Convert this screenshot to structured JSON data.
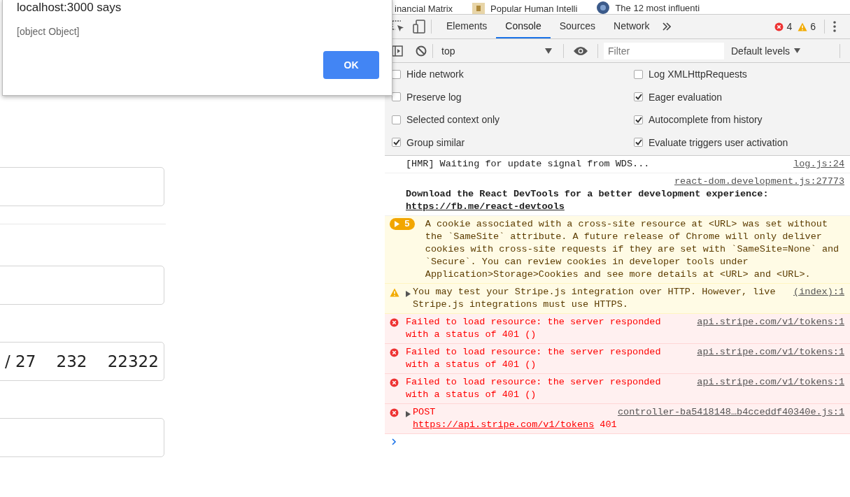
{
  "bookmarks": [
    {
      "label": "inancial Matrix"
    },
    {
      "label": "Popular Human Intelli"
    },
    {
      "label": "The 12 most influenti"
    }
  ],
  "dialog": {
    "title": "localhost:3000 says",
    "message": "[object Object]",
    "button": "OK"
  },
  "form": {
    "fields": [
      {
        "kind": "empty"
      },
      {
        "kind": "divider"
      },
      {
        "kind": "empty"
      },
      {
        "kind": "filled",
        "value": "/ 27    232    22322"
      },
      {
        "kind": "empty"
      }
    ]
  },
  "devtools": {
    "tabs": [
      {
        "label": "Elements",
        "selected": false
      },
      {
        "label": "Console",
        "selected": true
      },
      {
        "label": "Sources",
        "selected": false
      },
      {
        "label": "Network",
        "selected": false
      }
    ],
    "error_count": "4",
    "warning_count": "6",
    "context": "top",
    "filter": {
      "placeholder": "Filter"
    },
    "levels": "Default levels",
    "settings": [
      {
        "label": "Hide network",
        "checked": false
      },
      {
        "label": "Log XMLHttpRequests",
        "checked": false
      },
      {
        "label": "Preserve log",
        "checked": false
      },
      {
        "label": "Eager evaluation",
        "checked": true
      },
      {
        "label": "Selected context only",
        "checked": false
      },
      {
        "label": "Autocomplete from history",
        "checked": true
      },
      {
        "label": "Group similar",
        "checked": true
      },
      {
        "label": "Evaluate triggers user activation",
        "checked": true
      }
    ],
    "messages": [
      {
        "kind": "log",
        "text": "[HMR] Waiting for update signal from WDS...",
        "source": "log.js:24"
      },
      {
        "kind": "info",
        "text": "Download the React DevTools for a better development experience: ",
        "link": "https://fb.me/react-devtools",
        "source": "react-dom.development.js:27773"
      },
      {
        "kind": "warning_group",
        "count": "5",
        "text": "A cookie associated with a cross-site resource at <URL> was set without the `SameSite` attribute. A future release of Chrome will only deliver cookies with cross-site requests if they are set with `SameSite=None` and `Secure`. You can review cookies in developer tools under Application>Storage>Cookies and see more details at <URL> and <URL>."
      },
      {
        "kind": "warning",
        "text": "You may test your Stripe.js integration over HTTP. However, live Stripe.js integrations must use HTTPS.",
        "source": "(index):1"
      },
      {
        "kind": "error",
        "text": "Failed to load resource: the server responded with a status of 401 ()",
        "source": "api.stripe.com/v1/tokens:1"
      },
      {
        "kind": "error",
        "text": "Failed to load resource: the server responded with a status of 401 ()",
        "source": "api.stripe.com/v1/tokens:1"
      },
      {
        "kind": "error",
        "text": "Failed to load resource: the server responded with a status of 401 ()",
        "source": "api.stripe.com/v1/tokens:1"
      },
      {
        "kind": "error_request",
        "method": "POST",
        "link": "https://api.stripe.com/v1/tokens",
        "status": "401",
        "source": "controller-ba5418148…b4cceddf40340e.js:1"
      }
    ]
  }
}
